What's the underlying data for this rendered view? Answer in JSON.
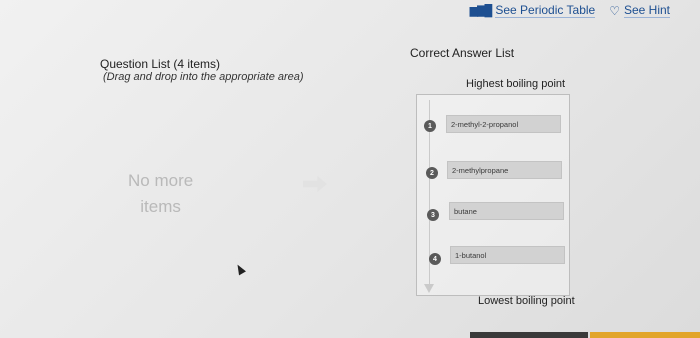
{
  "toplinks": {
    "periodic": "See Periodic Table",
    "hint": "See Hint"
  },
  "question_list": {
    "title": "Question List (4 items)",
    "subtitle": "(Drag and drop into the appropriate area)",
    "empty_line1": "No more",
    "empty_line2": "items"
  },
  "answer_list": {
    "title": "Correct Answer List",
    "top_label": "Highest boiling point",
    "bottom_label": "Lowest boiling point",
    "items": [
      {
        "num": "1",
        "label": "2-methyl-2-propanol"
      },
      {
        "num": "2",
        "label": "2-methylpropane"
      },
      {
        "num": "3",
        "label": "butane"
      },
      {
        "num": "4",
        "label": "1-butanol"
      }
    ]
  },
  "icons": {
    "periodic": "periodic-table-icon",
    "hint": "lightbulb-icon"
  }
}
